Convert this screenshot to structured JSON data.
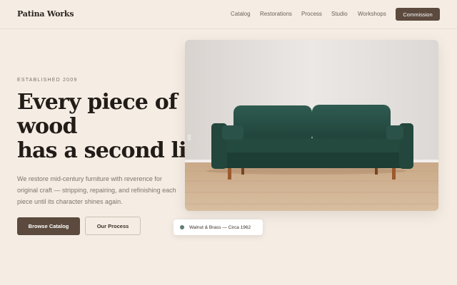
{
  "nav": {
    "brand": "Patina Works",
    "links": [
      "Catalog",
      "Restorations",
      "Process",
      "Studio",
      "Workshops"
    ],
    "cta": "Commission"
  },
  "hero": {
    "eyebrow": "ESTABLISHED 2009",
    "headline": [
      "Every piece of",
      "wood",
      "has a second life"
    ],
    "description": "We restore mid-century furniture with reverence for original craft — stripping, repairing, and refinishing each piece until its character shines again.",
    "primary_button": "Browse Catalog",
    "secondary_button": "Our Process",
    "caption": "Walnut & Brass — Circa 1962"
  },
  "colors": {
    "background": "#f5ede4",
    "accent": "#5c4a3e",
    "caption_dot": "#5f7d73"
  }
}
